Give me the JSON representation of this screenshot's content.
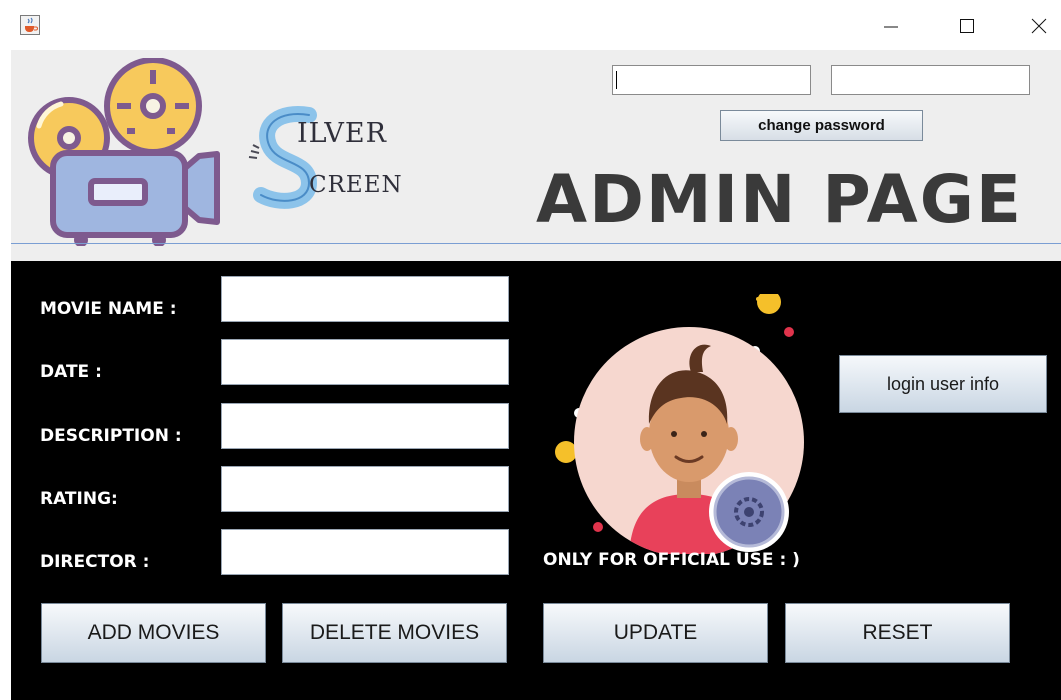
{
  "window": {
    "icons": {
      "app": "java-cup-icon",
      "minimize": "minimize-icon",
      "maximize": "maximize-icon",
      "close": "close-icon"
    }
  },
  "header": {
    "logo_word1": "ILVER",
    "logo_word2": "CREEN",
    "logo_letter": "S",
    "title": "ADMIN PAGE",
    "password_field_1": "",
    "password_field_2": "",
    "change_password_label": "change password"
  },
  "form": {
    "fields": [
      {
        "label": "MOVIE NAME :",
        "value": ""
      },
      {
        "label": "DATE :",
        "value": ""
      },
      {
        "label": "DESCRIPTION :",
        "value": ""
      },
      {
        "label": "RATING:",
        "value": ""
      },
      {
        "label": "DIRECTOR :",
        "value": ""
      }
    ]
  },
  "side": {
    "login_user_info_label": "login user info",
    "official_note": "ONLY FOR OFFICIAL USE : )"
  },
  "actions": [
    {
      "label": "ADD MOVIES"
    },
    {
      "label": "DELETE MOVIES"
    },
    {
      "label": "UPDATE"
    },
    {
      "label": "RESET"
    }
  ],
  "colors": {
    "panel_bg": "#000000",
    "header_bg": "#eeeeee",
    "accent_line": "#7a9ed3",
    "camera_body": "#9fb6e0",
    "reel_yellow": "#f7c95c",
    "avatar_bg": "#f6d7cf",
    "shirt_red": "#e8415a"
  }
}
